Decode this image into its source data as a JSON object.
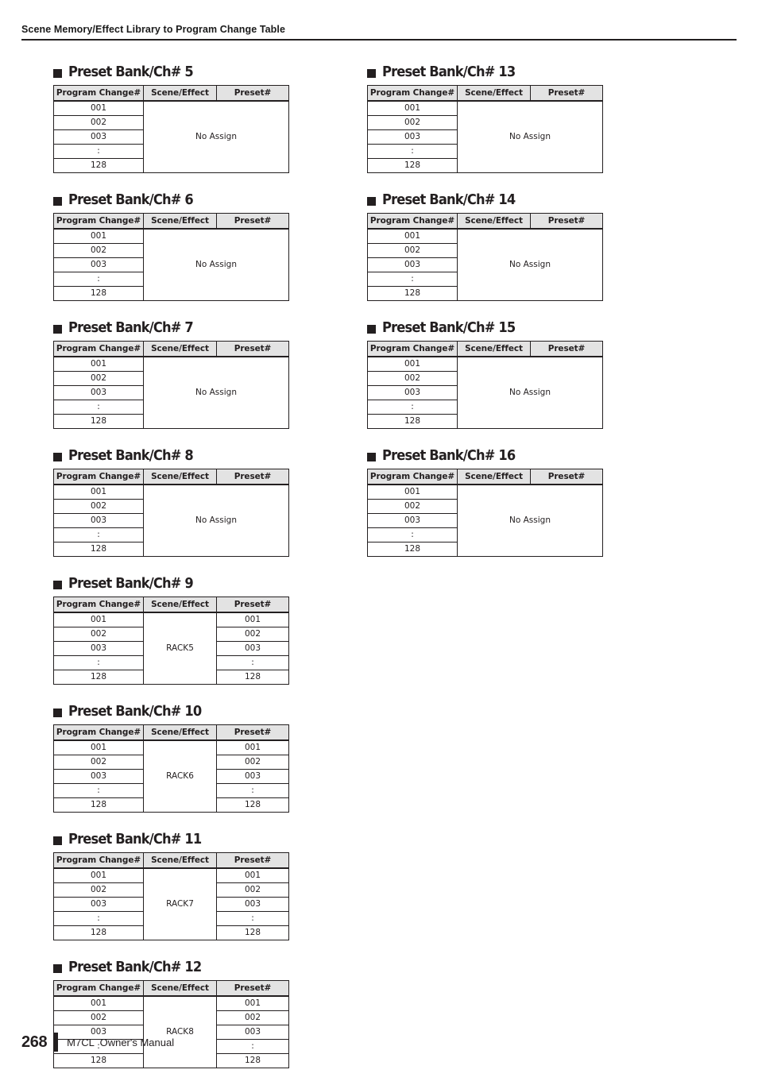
{
  "header": {
    "running_head": "Scene Memory/Effect Library to Program Change Table"
  },
  "table_columns": {
    "program_change": "Program Change#",
    "scene_effect": "Scene/Effect",
    "preset": "Preset#"
  },
  "row_labels": {
    "r1": "001",
    "r2": "002",
    "r3": "003",
    "r4": ":",
    "r5": "128"
  },
  "sections": {
    "left": [
      {
        "title": "Preset Bank/Ch# 5",
        "bullet": "square-bullet-icon",
        "program_change": [
          "001",
          "002",
          "003",
          ":",
          "128"
        ],
        "scene_effect": "No Assign",
        "scene_effect_merged": true,
        "preset_merged_with_scene": true,
        "preset": []
      },
      {
        "title": "Preset Bank/Ch# 6",
        "bullet": "square-bullet-icon",
        "program_change": [
          "001",
          "002",
          "003",
          ":",
          "128"
        ],
        "scene_effect": "No Assign",
        "scene_effect_merged": true,
        "preset_merged_with_scene": true,
        "preset": []
      },
      {
        "title": "Preset Bank/Ch# 7",
        "bullet": "square-bullet-icon",
        "program_change": [
          "001",
          "002",
          "003",
          ":",
          "128"
        ],
        "scene_effect": "No Assign",
        "scene_effect_merged": true,
        "preset_merged_with_scene": true,
        "preset": []
      },
      {
        "title": "Preset Bank/Ch# 8",
        "bullet": "square-bullet-icon",
        "program_change": [
          "001",
          "002",
          "003",
          ":",
          "128"
        ],
        "scene_effect": "No Assign",
        "scene_effect_merged": true,
        "preset_merged_with_scene": true,
        "preset": []
      },
      {
        "title": "Preset Bank/Ch# 9",
        "bullet": "square-bullet-icon",
        "program_change": [
          "001",
          "002",
          "003",
          ":",
          "128"
        ],
        "scene_effect": "RACK5",
        "scene_effect_merged": true,
        "preset_merged_with_scene": false,
        "preset": [
          "001",
          "002",
          "003",
          ":",
          "128"
        ]
      },
      {
        "title": "Preset Bank/Ch# 10",
        "bullet": "square-bullet-icon",
        "program_change": [
          "001",
          "002",
          "003",
          ":",
          "128"
        ],
        "scene_effect": "RACK6",
        "scene_effect_merged": true,
        "preset_merged_with_scene": false,
        "preset": [
          "001",
          "002",
          "003",
          ":",
          "128"
        ]
      },
      {
        "title": "Preset Bank/Ch# 11",
        "bullet": "square-bullet-icon",
        "program_change": [
          "001",
          "002",
          "003",
          ":",
          "128"
        ],
        "scene_effect": "RACK7",
        "scene_effect_merged": true,
        "preset_merged_with_scene": false,
        "preset": [
          "001",
          "002",
          "003",
          ":",
          "128"
        ]
      },
      {
        "title": "Preset Bank/Ch# 12",
        "bullet": "square-bullet-icon",
        "program_change": [
          "001",
          "002",
          "003",
          ":",
          "128"
        ],
        "scene_effect": "RACK8",
        "scene_effect_merged": true,
        "preset_merged_with_scene": false,
        "preset": [
          "001",
          "002",
          "003",
          ":",
          "128"
        ]
      }
    ],
    "right": [
      {
        "title": "Preset Bank/Ch# 13",
        "bullet": "square-bullet-icon",
        "program_change": [
          "001",
          "002",
          "003",
          ":",
          "128"
        ],
        "scene_effect": "No Assign",
        "scene_effect_merged": true,
        "preset_merged_with_scene": true,
        "preset": []
      },
      {
        "title": "Preset Bank/Ch# 14",
        "bullet": "square-bullet-icon",
        "program_change": [
          "001",
          "002",
          "003",
          ":",
          "128"
        ],
        "scene_effect": "No Assign",
        "scene_effect_merged": true,
        "preset_merged_with_scene": true,
        "preset": []
      },
      {
        "title": "Preset Bank/Ch# 15",
        "bullet": "square-bullet-icon",
        "program_change": [
          "001",
          "002",
          "003",
          ":",
          "128"
        ],
        "scene_effect": "No Assign",
        "scene_effect_merged": true,
        "preset_merged_with_scene": true,
        "preset": []
      },
      {
        "title": "Preset Bank/Ch# 16",
        "bullet": "square-bullet-icon",
        "program_change": [
          "001",
          "002",
          "003",
          ":",
          "128"
        ],
        "scene_effect": "No Assign",
        "scene_effect_merged": true,
        "preset_merged_with_scene": true,
        "preset": []
      }
    ]
  },
  "footer": {
    "page_number": "268",
    "manual_title": "M7CL  Owner's Manual"
  },
  "colors": {
    "ink": "#231f20",
    "header_row_fill": "#e3e3e3",
    "page_background": "#ffffff"
  }
}
